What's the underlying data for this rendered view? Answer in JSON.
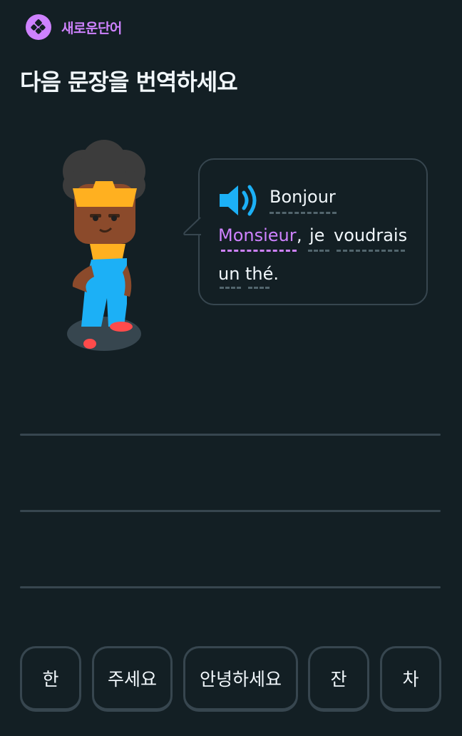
{
  "header": {
    "badge_icon": "new-word-icon",
    "badge_label": "새로운단어",
    "title": "다음 문장을 번역하세요"
  },
  "bubble": {
    "audio_icon": "speaker-icon",
    "line1": [
      "Bonjour"
    ],
    "line2_new_word": "Monsieur",
    "line2_punct": ",",
    "line2": [
      "je",
      "voudrais"
    ],
    "line3": [
      "un",
      "thé."
    ]
  },
  "answer_lines": 3,
  "word_bank": [
    "한",
    "주세요",
    "안녕하세요",
    "잔",
    "차"
  ],
  "colors": {
    "background": "#131f24",
    "accent_new_word": "#ce82ff",
    "speaker": "#1cb0f6",
    "border": "#37464f",
    "text": "#f1f7fb"
  }
}
